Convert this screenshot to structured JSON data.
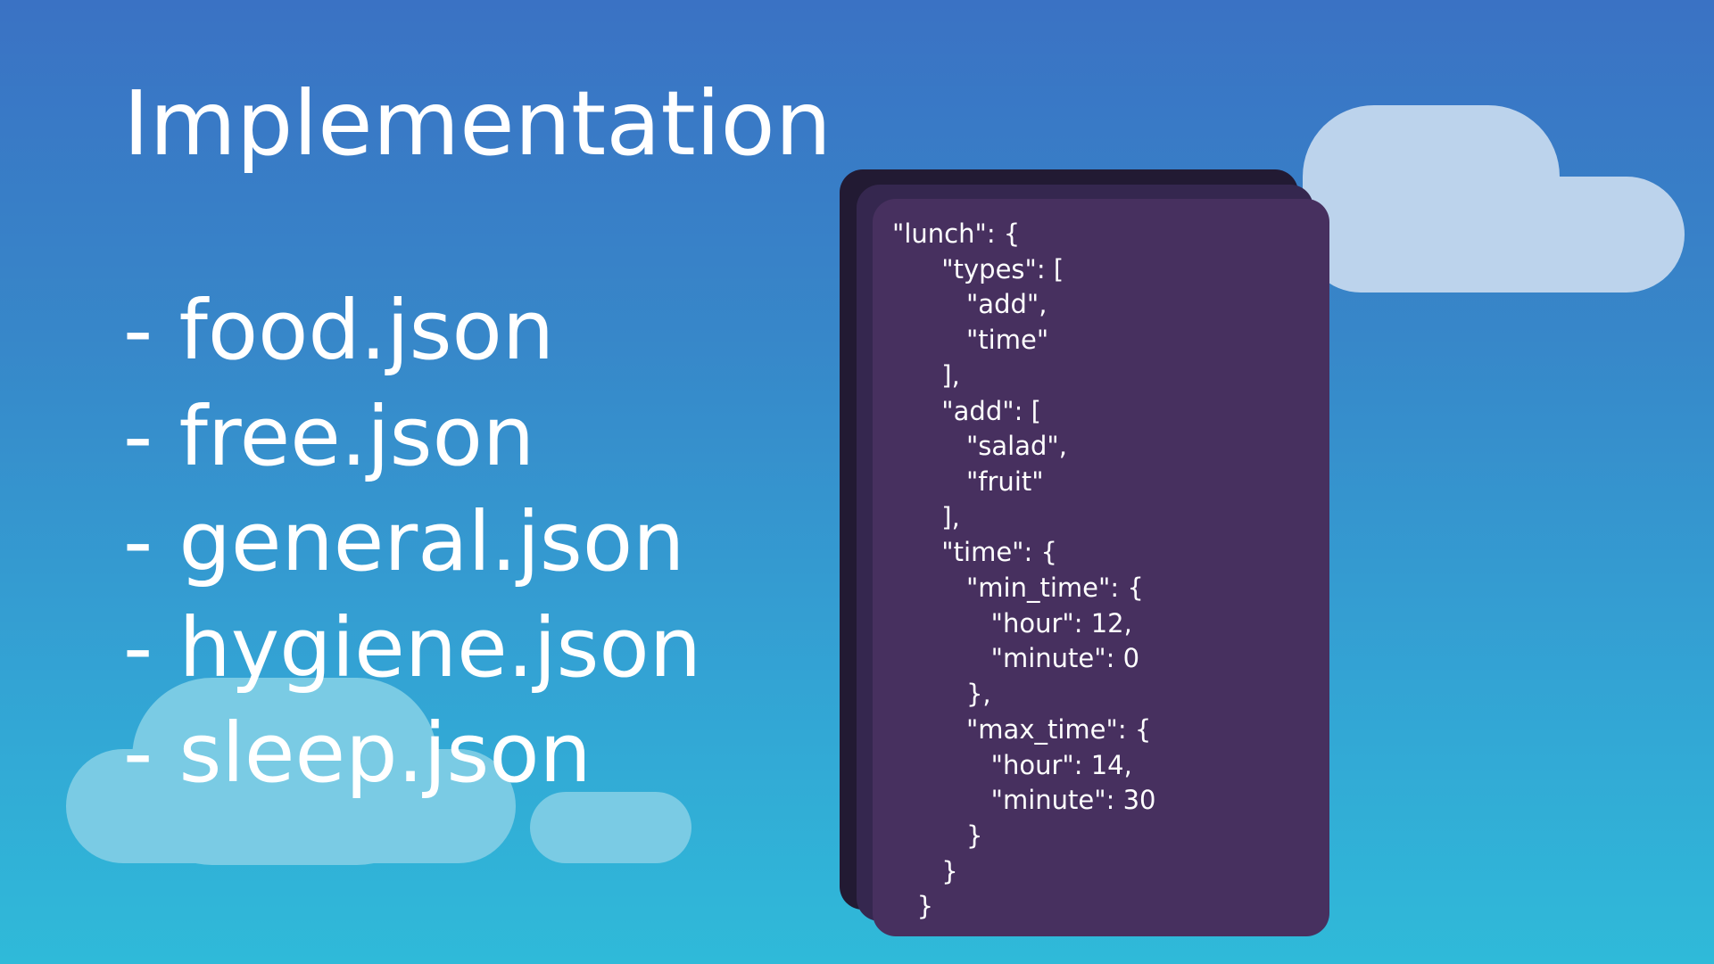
{
  "slide": {
    "title": "Implementation",
    "files": [
      "- food.json",
      "- free.json",
      "- general.json",
      "- hygiene.json",
      "- sleep.json"
    ],
    "code": "\"lunch\": {\n      \"types\": [\n         \"add\",\n         \"time\"\n      ],\n      \"add\": [\n         \"salad\",\n         \"fruit\"\n      ],\n      \"time\": {\n         \"min_time\": {\n            \"hour\": 12,\n            \"minute\": 0\n         },\n         \"max_time\": {\n            \"hour\": 14,\n            \"minute\": 30\n         }\n      }\n   }"
  },
  "colors": {
    "background_top": "#3a72c4",
    "background_bottom": "#2fbad9",
    "card_front": "#47305f",
    "card_mid": "#35274f",
    "card_back": "#221a33",
    "cloud_top_right": "#bcd3ec",
    "cloud_bottom_left": "#7acbe4",
    "text": "#ffffff"
  }
}
